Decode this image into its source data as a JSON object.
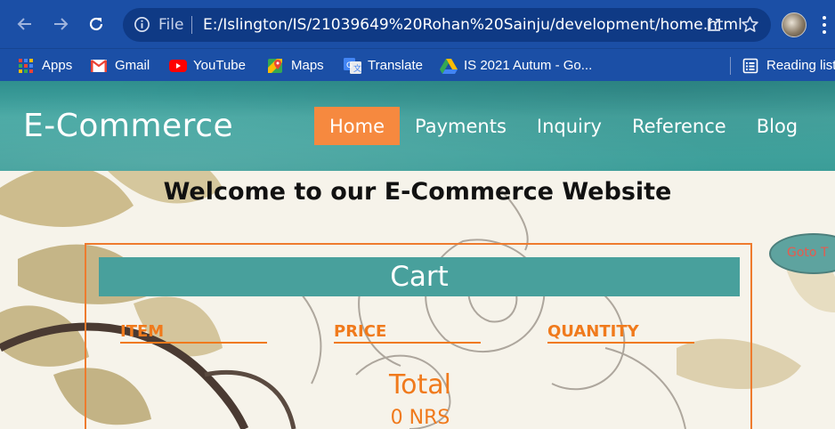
{
  "browser": {
    "omnibox": {
      "scheme_label": "File",
      "url": "E:/Islington/IS/21039649%20Rohan%20Sainju/development/home.html"
    },
    "bookmarks": [
      {
        "label": "Apps",
        "icon": "apps-grid-icon"
      },
      {
        "label": "Gmail",
        "icon": "gmail-icon"
      },
      {
        "label": "YouTube",
        "icon": "youtube-icon"
      },
      {
        "label": "Maps",
        "icon": "maps-icon"
      },
      {
        "label": "Translate",
        "icon": "translate-icon"
      },
      {
        "label": "IS 2021 Autum - Go...",
        "icon": "google-drive-icon"
      },
      {
        "label": "Reading list",
        "icon": "reading-list-icon"
      }
    ]
  },
  "site": {
    "logo": "E-Commerce",
    "nav": [
      {
        "label": "Home",
        "active": true
      },
      {
        "label": "Payments",
        "active": false
      },
      {
        "label": "Inquiry",
        "active": false
      },
      {
        "label": "Reference",
        "active": false
      },
      {
        "label": "Blog",
        "active": false
      }
    ],
    "welcome": "Welcome to our E-Commerce Website",
    "goto_button": "Goto T",
    "cart": {
      "title": "Cart",
      "columns": [
        "ITEM",
        "PRICE",
        "QUANTITY"
      ],
      "total_label": "Total",
      "total_value": "0 NRS"
    },
    "colors": {
      "header_teal": "#3b9d98",
      "accent_orange": "#f6893f",
      "text_orange": "#f07a1c"
    }
  }
}
